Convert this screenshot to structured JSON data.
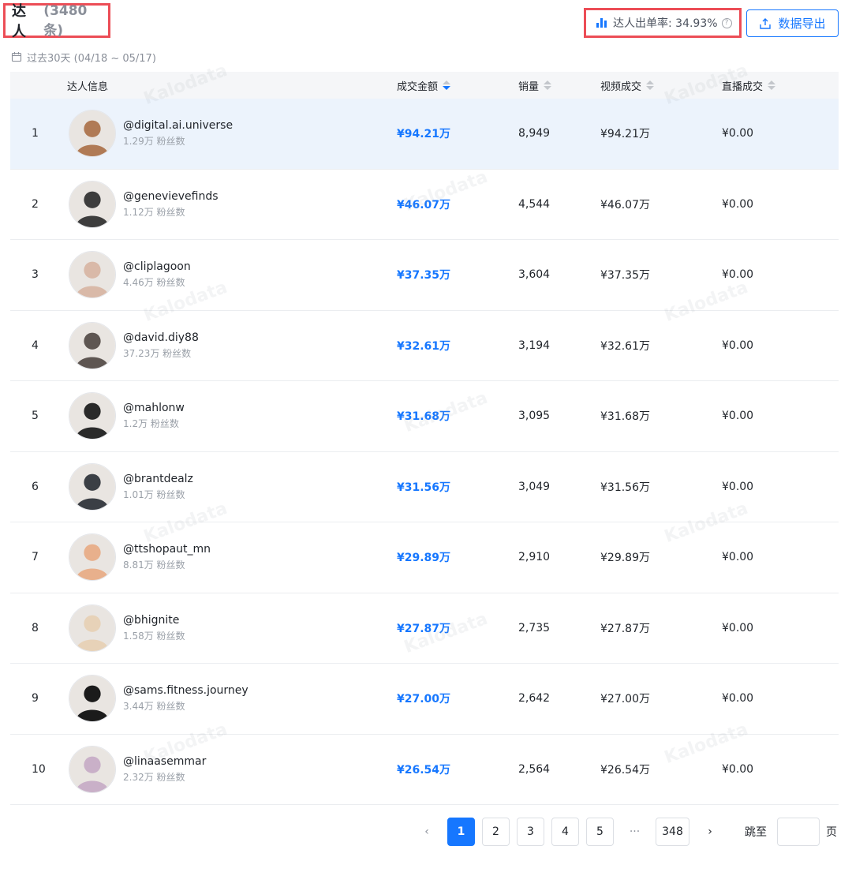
{
  "header": {
    "title": "达人",
    "count": "(3480 条)",
    "rate_label": "达人出单率: 34.93%",
    "help_glyph": "?",
    "export_label": "数据导出",
    "date_range": "过去30天 (04/18 ~ 05/17)"
  },
  "table": {
    "columns": [
      "达人信息",
      "成交金额",
      "销量",
      "视频成交",
      "直播成交"
    ],
    "rows": [
      {
        "rank": "1",
        "handle": "@digital.ai.universe",
        "fans": "1.29万 粉丝数",
        "gmv": "¥94.21万",
        "sales": "8,949",
        "video": "¥94.21万",
        "live": "¥0.00"
      },
      {
        "rank": "2",
        "handle": "@genevievefinds",
        "fans": "1.12万 粉丝数",
        "gmv": "¥46.07万",
        "sales": "4,544",
        "video": "¥46.07万",
        "live": "¥0.00"
      },
      {
        "rank": "3",
        "handle": "@cliplagoon",
        "fans": "4.46万 粉丝数",
        "gmv": "¥37.35万",
        "sales": "3,604",
        "video": "¥37.35万",
        "live": "¥0.00"
      },
      {
        "rank": "4",
        "handle": "@david.diy88",
        "fans": "37.23万 粉丝数",
        "gmv": "¥32.61万",
        "sales": "3,194",
        "video": "¥32.61万",
        "live": "¥0.00"
      },
      {
        "rank": "5",
        "handle": "@mahlonw",
        "fans": "1.2万 粉丝数",
        "gmv": "¥31.68万",
        "sales": "3,095",
        "video": "¥31.68万",
        "live": "¥0.00"
      },
      {
        "rank": "6",
        "handle": "@brantdealz",
        "fans": "1.01万 粉丝数",
        "gmv": "¥31.56万",
        "sales": "3,049",
        "video": "¥31.56万",
        "live": "¥0.00"
      },
      {
        "rank": "7",
        "handle": "@ttshopaut_mn",
        "fans": "8.81万 粉丝数",
        "gmv": "¥29.89万",
        "sales": "2,910",
        "video": "¥29.89万",
        "live": "¥0.00"
      },
      {
        "rank": "8",
        "handle": "@bhignite",
        "fans": "1.58万 粉丝数",
        "gmv": "¥27.87万",
        "sales": "2,735",
        "video": "¥27.87万",
        "live": "¥0.00"
      },
      {
        "rank": "9",
        "handle": "@sams.fitness.journey",
        "fans": "3.44万 粉丝数",
        "gmv": "¥27.00万",
        "sales": "2,642",
        "video": "¥27.00万",
        "live": "¥0.00"
      },
      {
        "rank": "10",
        "handle": "@linaasemmar",
        "fans": "2.32万 粉丝数",
        "gmv": "¥26.54万",
        "sales": "2,564",
        "video": "¥26.54万",
        "live": "¥0.00"
      }
    ]
  },
  "avatar_colors": [
    "#b07a55",
    "#3d3d3d",
    "#d9b9a8",
    "#5e5652",
    "#2a2a2a",
    "#3b3f45",
    "#e8b08c",
    "#e7d2b8",
    "#1b1b1b",
    "#c9b0c8"
  ],
  "pagination": {
    "prev": "‹",
    "pages": [
      "1",
      "2",
      "3",
      "4",
      "5"
    ],
    "ellipsis": "···",
    "last": "348",
    "next": "›",
    "jump_label": "跳至",
    "page_suffix": "页",
    "current": "1"
  },
  "watermark": "Kalodata",
  "colors": {
    "accent": "#1677ff",
    "highlight_row": "#ecf3fc",
    "callout_border": "#ec4d56"
  }
}
